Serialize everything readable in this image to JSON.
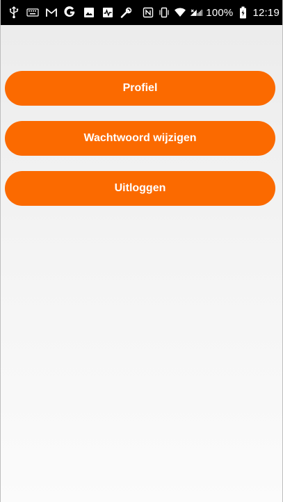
{
  "status_bar": {
    "battery_percent": "100%",
    "time": "12:19",
    "left_icons": [
      "usb-icon",
      "keyboard-icon",
      "gmail-icon",
      "google-icon",
      "photo-icon",
      "activity-icon",
      "wrench-icon"
    ],
    "right_icons": [
      "nfc-icon",
      "vibrate-icon",
      "wifi-icon",
      "signal-icon",
      "battery-icon"
    ]
  },
  "menu": {
    "profile_label": "Profiel",
    "change_password_label": "Wachtwoord wijzigen",
    "logout_label": "Uitloggen"
  },
  "colors": {
    "accent": "#fb6a00",
    "status_bar": "#000000"
  }
}
